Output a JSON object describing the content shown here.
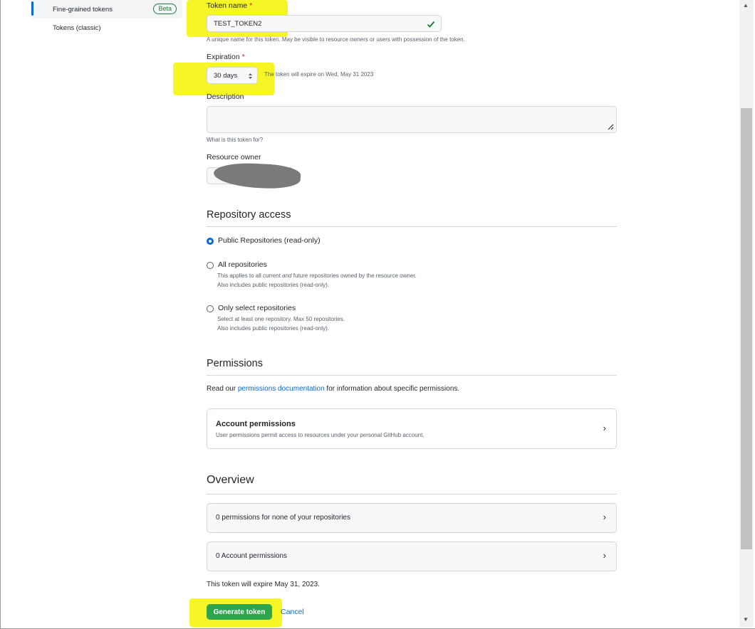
{
  "sidebar": {
    "items": [
      {
        "label": "Fine-grained tokens",
        "badge": "Beta"
      },
      {
        "label": "Tokens (classic)"
      }
    ]
  },
  "form": {
    "token_name": {
      "label": "Token name",
      "required_mark": "*",
      "value": "TEST_TOKEN2",
      "help": "A unique name for this token. May be visible to resource owners or users with possession of the token."
    },
    "expiration": {
      "label": "Expiration",
      "required_mark": "*",
      "value": "30 days",
      "note": "The token will expire on Wed, May 31 2023"
    },
    "description": {
      "label": "Description",
      "value": "",
      "help": "What is this token for?"
    },
    "resource_owner": {
      "label": "Resource owner"
    }
  },
  "repository_access": {
    "title": "Repository access",
    "options": [
      {
        "label": "Public Repositories (read-only)",
        "checked": true,
        "notes": []
      },
      {
        "label": "All repositories",
        "checked": false,
        "notes_pre": "This applies to all current ",
        "notes_em": "and",
        "notes_post": " future repositories owned by the resource owner.",
        "notes2": "Also includes public repositories (read-only)."
      },
      {
        "label": "Only select repositories",
        "checked": false,
        "notes1": "Select at least one repository. Max 50 repositories.",
        "notes2": "Also includes public repositories (read-only)."
      }
    ]
  },
  "permissions": {
    "title": "Permissions",
    "intro_pre": "Read our ",
    "intro_link": "permissions documentation",
    "intro_post": " for information about specific permissions.",
    "account": {
      "title": "Account permissions",
      "desc": "User permissions permit access to resources under your personal GitHub account."
    }
  },
  "overview": {
    "title": "Overview",
    "rows": [
      {
        "label": "0 permissions for none of your repositories"
      },
      {
        "label": "0 Account permissions"
      }
    ],
    "expiry_note": "This token will expire May 31, 2023."
  },
  "actions": {
    "generate": "Generate token",
    "cancel": "Cancel"
  },
  "colors": {
    "accent": "#0969da",
    "success": "#2da44e",
    "highlight": "#f5f500"
  },
  "icons": [
    "check-icon",
    "select-arrows-icon",
    "resize-handle-icon",
    "chevron-right-icon",
    "scroll-up-arrow-icon",
    "scroll-down-arrow-icon"
  ]
}
